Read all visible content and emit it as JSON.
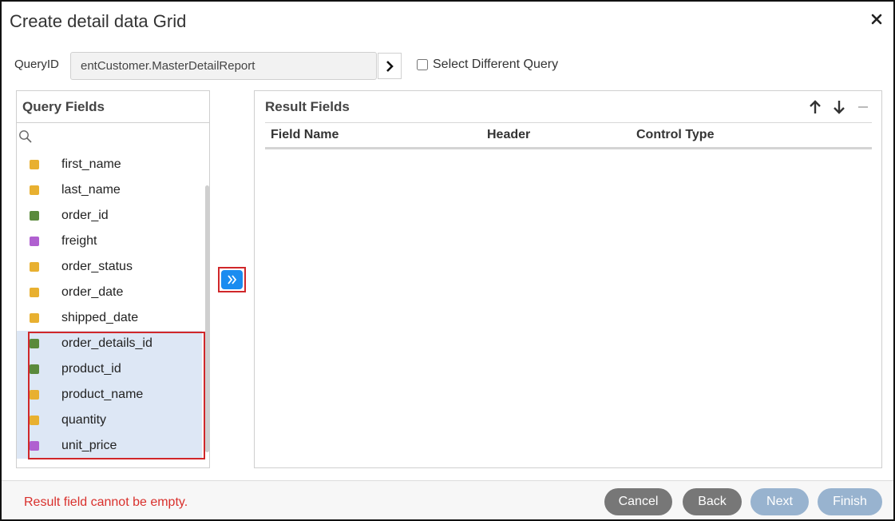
{
  "dialog": {
    "title": "Create detail data Grid",
    "close_icon": "close-icon"
  },
  "query": {
    "label": "QueryID",
    "value": "entCustomer.MasterDetailReport",
    "select_different_label": "Select Different Query",
    "select_different_checked": false
  },
  "query_fields": {
    "title": "Query Fields",
    "items": [
      {
        "name": "first_name",
        "color": "#e8b030",
        "selected": false
      },
      {
        "name": "last_name",
        "color": "#e8b030",
        "selected": false
      },
      {
        "name": "order_id",
        "color": "#5a8a3c",
        "selected": false
      },
      {
        "name": "freight",
        "color": "#b060d0",
        "selected": false
      },
      {
        "name": "order_status",
        "color": "#e8b030",
        "selected": false
      },
      {
        "name": "order_date",
        "color": "#e8b030",
        "selected": false
      },
      {
        "name": "shipped_date",
        "color": "#e8b030",
        "selected": false
      },
      {
        "name": "order_details_id",
        "color": "#5a8a3c",
        "selected": true
      },
      {
        "name": "product_id",
        "color": "#5a8a3c",
        "selected": true
      },
      {
        "name": "product_name",
        "color": "#e8b030",
        "selected": true
      },
      {
        "name": "quantity",
        "color": "#e8b030",
        "selected": true
      },
      {
        "name": "unit_price",
        "color": "#b060d0",
        "selected": true
      }
    ]
  },
  "result_fields": {
    "title": "Result Fields",
    "columns": [
      "Field Name",
      "Header",
      "Control Type"
    ]
  },
  "footer": {
    "error": "Result field cannot be empty.",
    "buttons": {
      "cancel": "Cancel",
      "back": "Back",
      "next": "Next",
      "finish": "Finish"
    }
  },
  "colors": {
    "accent": "#1a8cf0",
    "error": "#d9302c",
    "highlight": "#d0272a",
    "selected_bg": "#dde7f5",
    "button_dark": "#777777",
    "button_disabled": "#98b3cf"
  }
}
